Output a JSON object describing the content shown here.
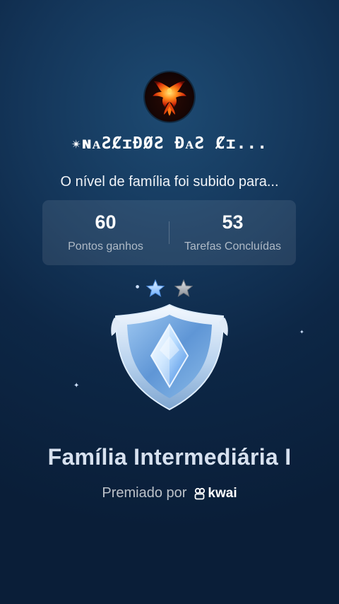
{
  "profile": {
    "display_name": "✴ɴᴀƧȻɪƉØƧ ƉᴀƧ Ȼɪ...",
    "avatar_icon": "phoenix-icon"
  },
  "message": {
    "subtitle": "O nível de família foi subido para..."
  },
  "stats": {
    "points": {
      "value": "60",
      "label": "Pontos ganhos"
    },
    "tasks": {
      "value": "53",
      "label": "Tarefas Concluídas"
    }
  },
  "badge": {
    "stars_filled": 1,
    "stars_total": 2,
    "icon": "shield-crystal-icon"
  },
  "level": {
    "title": "Família Intermediária I"
  },
  "awarded_by": {
    "label": "Premiado por",
    "brand": "kwai"
  },
  "colors": {
    "background_top": "#1d4a72",
    "background_bottom": "#0a1e38",
    "star_blue": "#8fc4ff",
    "star_gray": "#9aa0a8"
  }
}
